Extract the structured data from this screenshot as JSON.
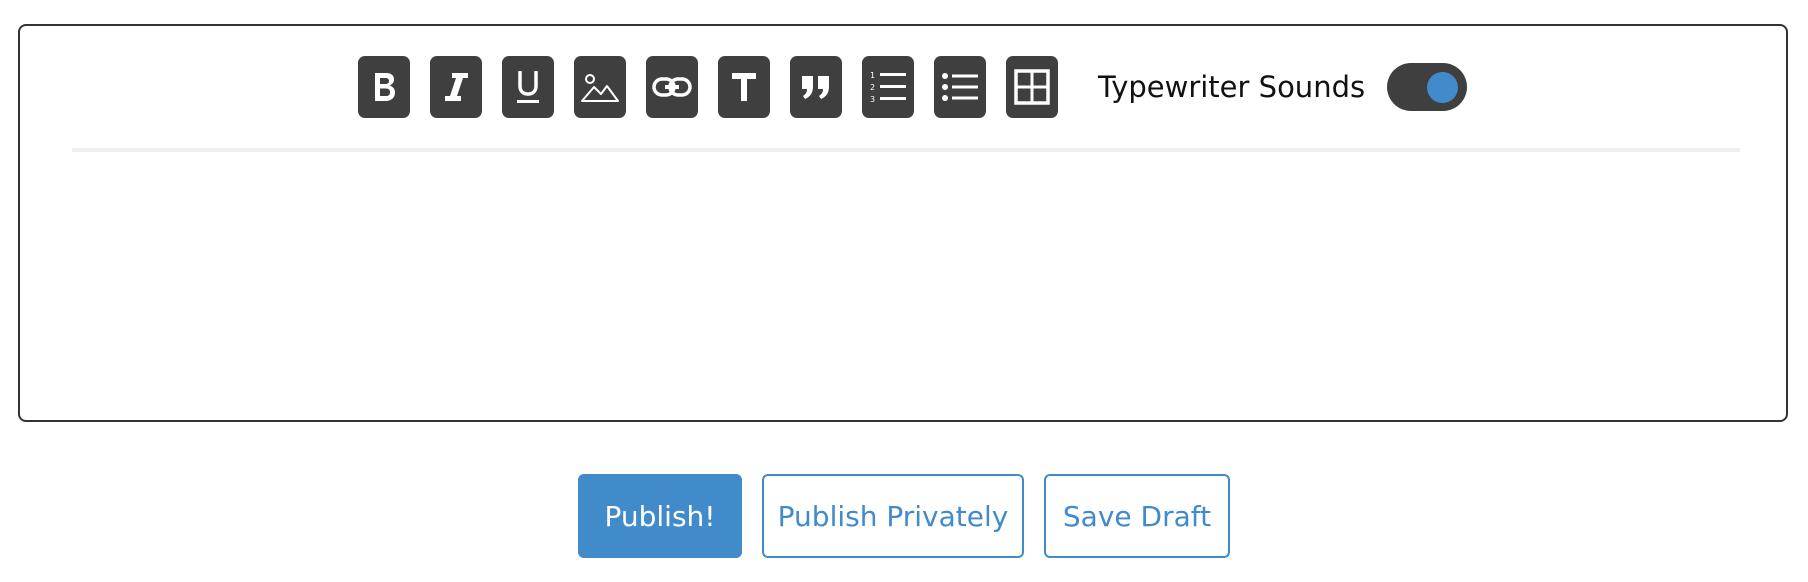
{
  "toolbar": {
    "buttons": [
      {
        "icon": "bold-icon"
      },
      {
        "icon": "italic-icon"
      },
      {
        "icon": "underline-icon"
      },
      {
        "icon": "image-icon"
      },
      {
        "icon": "link-icon"
      },
      {
        "icon": "text-icon"
      },
      {
        "icon": "quote-icon"
      },
      {
        "icon": "ordered-list-icon"
      },
      {
        "icon": "unordered-list-icon"
      },
      {
        "icon": "table-icon"
      }
    ],
    "typewriter_label": "Typewriter Sounds",
    "typewriter_enabled": true
  },
  "editor": {
    "content": ""
  },
  "actions": {
    "publish_label": "Publish!",
    "publish_privately_label": "Publish Privately",
    "save_draft_label": "Save Draft"
  },
  "colors": {
    "accent": "#428bca",
    "toolbar_button": "#3f3f3f",
    "border": "#333333"
  }
}
